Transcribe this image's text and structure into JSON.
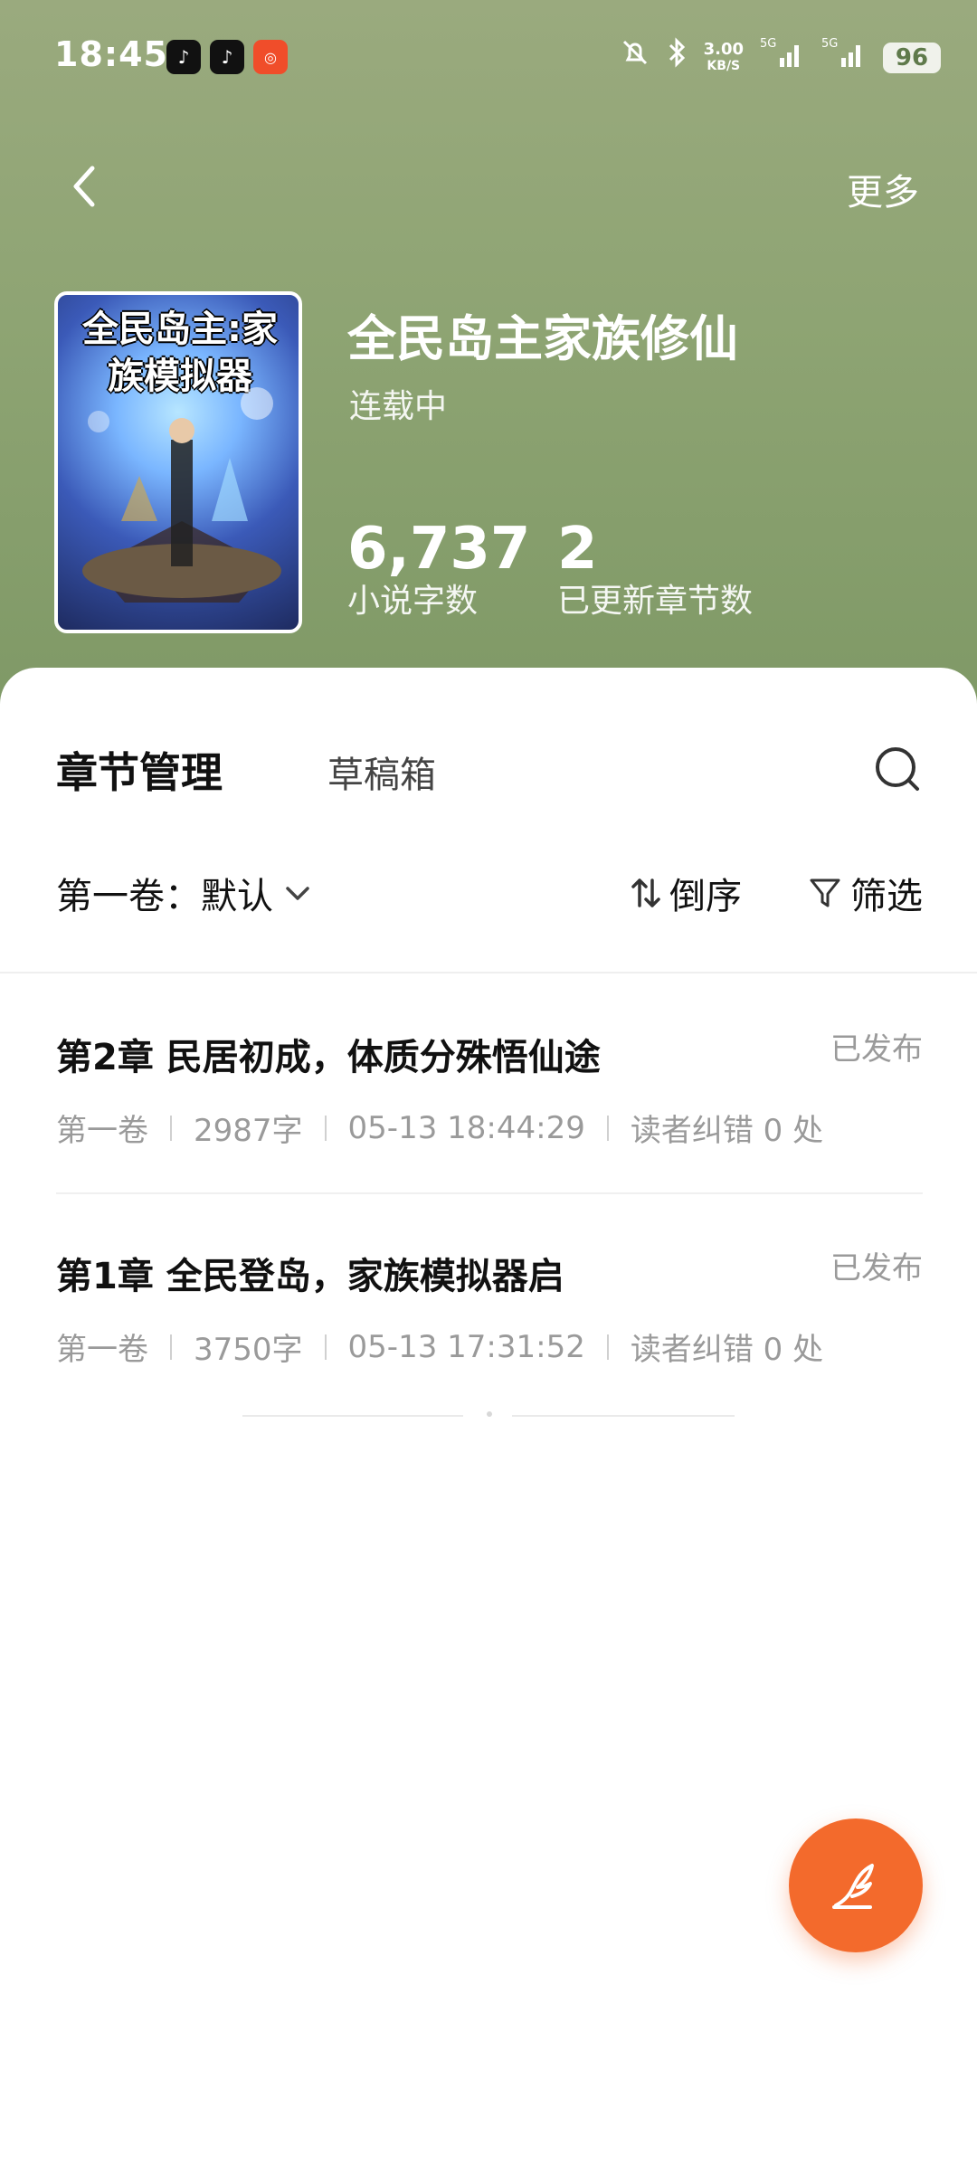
{
  "status_bar": {
    "time": "18:45",
    "speed": "3.00",
    "speed_unit": "KB/S",
    "network1": "5G",
    "network2": "5G",
    "battery": "96"
  },
  "nav": {
    "more_label": "更多"
  },
  "book": {
    "cover_title": "全民岛主:家族模拟器",
    "title": "全民岛主家族修仙",
    "status": "连载中",
    "word_count": "6,737",
    "word_count_label": "小说字数",
    "chapter_count": "2",
    "chapter_count_label": "已更新章节数"
  },
  "tabs": {
    "active": "章节管理",
    "drafts": "草稿箱"
  },
  "filters": {
    "volume": "第一卷：默认",
    "order": "倒序",
    "filter": "筛选"
  },
  "chapters": [
    {
      "title": "第2章 民居初成，体质分殊悟仙途",
      "state": "已发布",
      "volume": "第一卷",
      "words": "2987字",
      "time": "05-13 18:44:29",
      "errors": "读者纠错 0 处"
    },
    {
      "title": "第1章 全民登岛，家族模拟器启",
      "state": "已发布",
      "volume": "第一卷",
      "words": "3750字",
      "time": "05-13 17:31:52",
      "errors": "读者纠错 0 处"
    }
  ],
  "colors": {
    "hero": "#8ea473",
    "accent": "#f36a2c"
  }
}
